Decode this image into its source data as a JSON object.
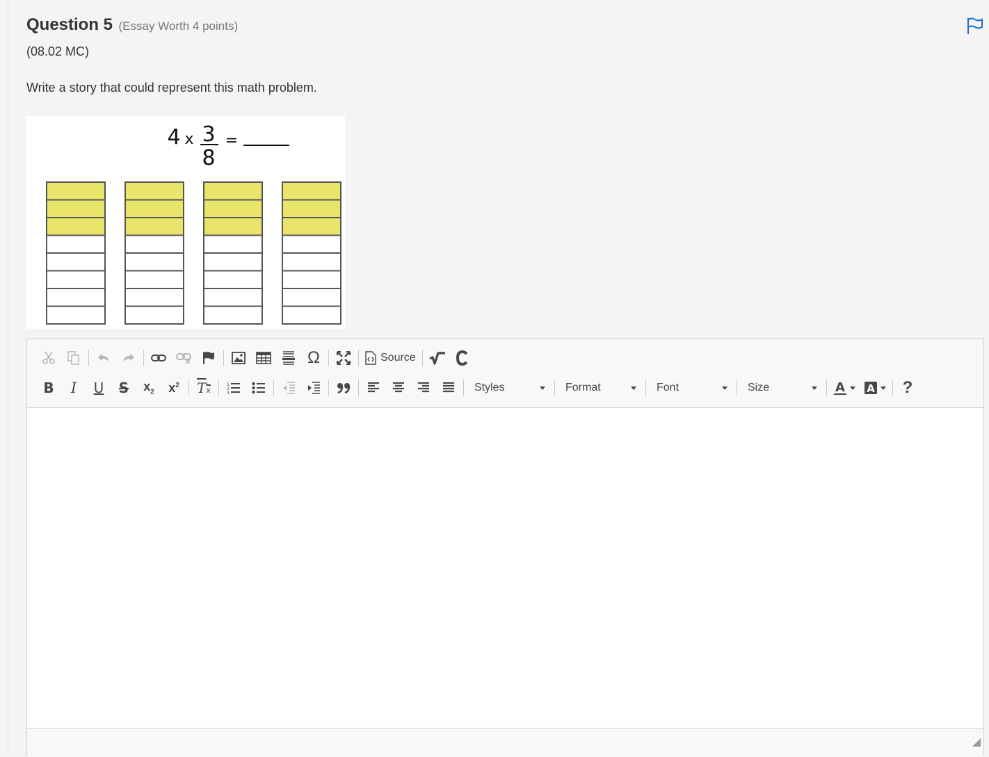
{
  "question": {
    "title": "Question 5",
    "meta": "(Essay Worth 4 points)",
    "code": "(08.02 MC)",
    "prompt": "Write a story that could represent this math problem."
  },
  "figure": {
    "whole_number": "4",
    "operator": "x",
    "numerator": "3",
    "denominator": "8",
    "equals": "=",
    "bar_count": 4,
    "parts_per_bar": 8,
    "shaded_parts": 3,
    "shade_color": "#e8e56a"
  },
  "toolbar": {
    "row1": [
      "cut-icon",
      "copy-icon",
      "undo-icon",
      "redo-icon",
      "link-icon",
      "unlink-icon",
      "anchor-icon",
      "image-icon",
      "table-icon",
      "horizontal-line-icon",
      "special-char-icon",
      "maximize-icon",
      "source-icon",
      "math-icon",
      "chem-icon"
    ],
    "source_label": "Source",
    "styles_label": "Styles",
    "format_label": "Format",
    "font_label": "Font",
    "size_label": "Size",
    "help_label": "?"
  },
  "colors": {
    "background": "#f4f4f4",
    "accent": "#1a6fc4",
    "icon": "#474747",
    "icon_disabled": "#b5b5b5"
  }
}
